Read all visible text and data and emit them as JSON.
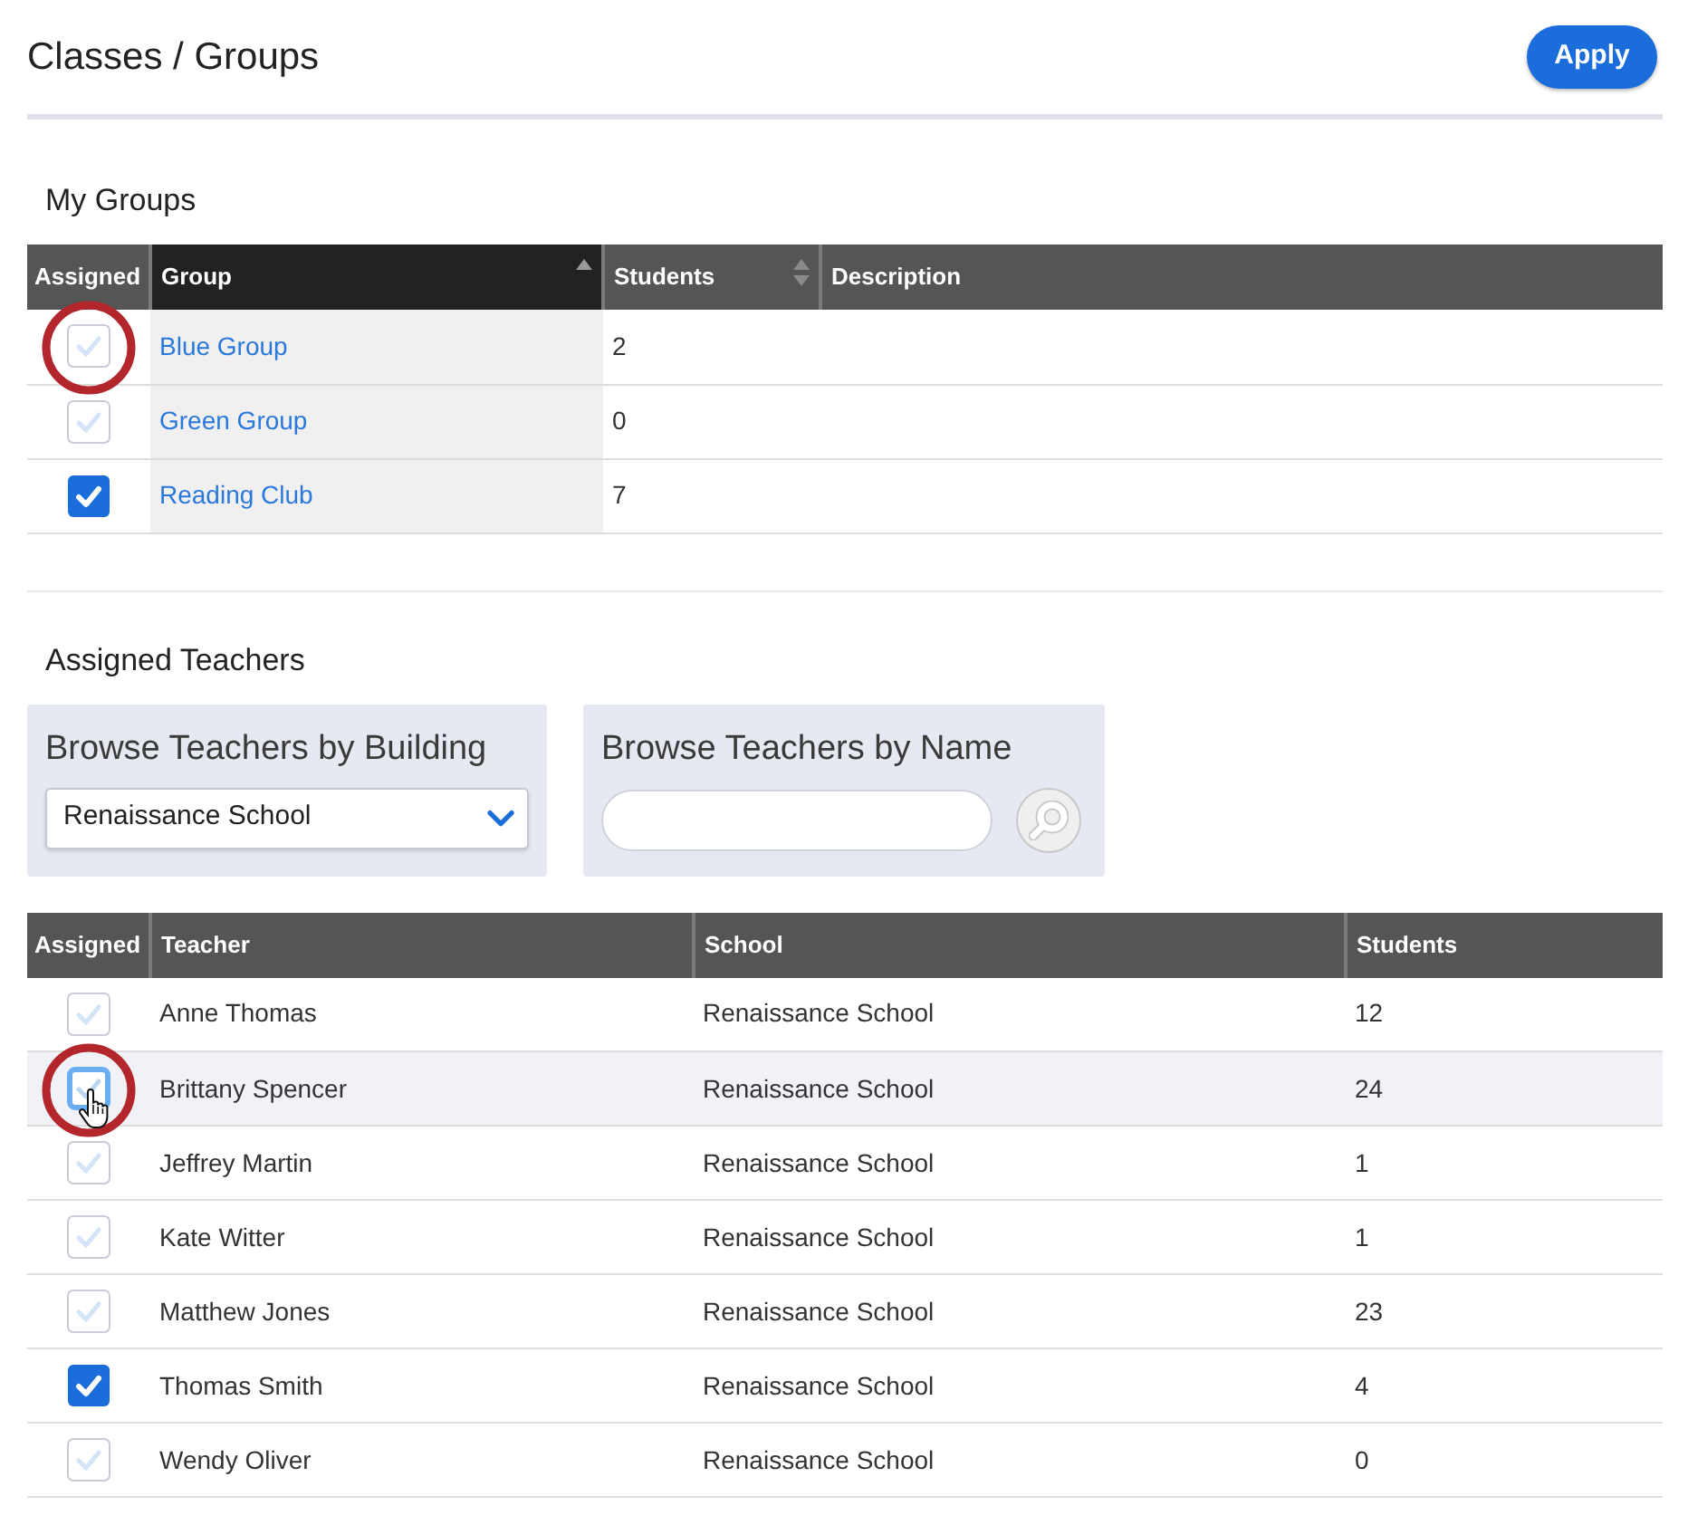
{
  "header": {
    "title": "Classes / Groups",
    "apply_button": "Apply"
  },
  "my_groups": {
    "heading": "My Groups",
    "columns": [
      {
        "label": "Assigned",
        "sortable": false,
        "sorted": false
      },
      {
        "label": "Group",
        "sortable": true,
        "sorted": true
      },
      {
        "label": "Students",
        "sortable": true,
        "sorted": false
      },
      {
        "label": "Description",
        "sortable": false,
        "sorted": false
      }
    ],
    "rows": [
      {
        "assigned": false,
        "circled": true,
        "group": "Blue Group",
        "students": "2"
      },
      {
        "assigned": false,
        "circled": false,
        "group": "Green Group",
        "students": "0"
      },
      {
        "assigned": true,
        "circled": false,
        "group": "Reading Club",
        "students": "7"
      }
    ]
  },
  "assigned_teachers": {
    "heading": "Assigned Teachers",
    "filters": [
      {
        "kind": "select",
        "label": "Browse Teachers by Building",
        "value": "Renaissance School"
      },
      {
        "kind": "search",
        "label": "Browse Teachers by Name"
      }
    ],
    "columns": [
      {
        "label": "Assigned"
      },
      {
        "label": "Teacher"
      },
      {
        "label": "School"
      },
      {
        "label": "Students"
      }
    ],
    "rows": [
      {
        "assigned": false,
        "circled": false,
        "hovered": false,
        "teacher": "Anne Thomas",
        "school": "Renaissance School",
        "students": "12"
      },
      {
        "assigned": false,
        "circled": true,
        "hovered": true,
        "teacher": "Brittany Spencer",
        "school": "Renaissance School",
        "students": "24"
      },
      {
        "assigned": false,
        "circled": false,
        "hovered": false,
        "teacher": "Jeffrey Martin",
        "school": "Renaissance School",
        "students": "1"
      },
      {
        "assigned": false,
        "circled": false,
        "hovered": false,
        "teacher": "Kate Witter",
        "school": "Renaissance School",
        "students": "1"
      },
      {
        "assigned": false,
        "circled": false,
        "hovered": false,
        "teacher": "Matthew Jones",
        "school": "Renaissance School",
        "students": "23"
      },
      {
        "assigned": true,
        "circled": false,
        "hovered": false,
        "teacher": "Thomas Smith",
        "school": "Renaissance School",
        "students": "4"
      },
      {
        "assigned": false,
        "circled": false,
        "hovered": false,
        "teacher": "Wendy Oliver",
        "school": "Renaissance School",
        "students": "0"
      }
    ]
  }
}
